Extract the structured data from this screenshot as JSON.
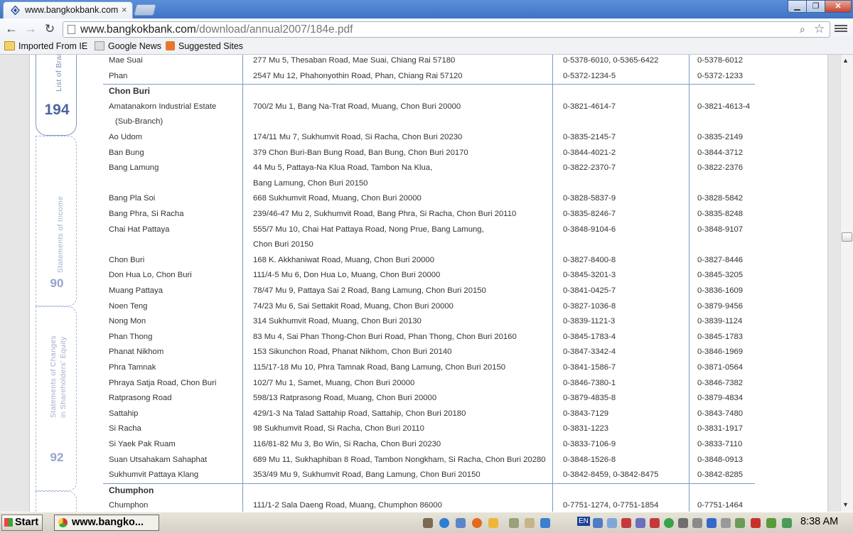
{
  "browser": {
    "tab_title": "www.bangkokbank.com",
    "tab_close": "×",
    "url_domain": "www.bangkokbank.com",
    "url_path": "/download/annual2007/184e.pdf",
    "window_buttons": {
      "minimize": "▁",
      "maximize": "❐",
      "close": "✕"
    }
  },
  "bookmarks": [
    {
      "label": "Imported From IE",
      "icon": "folder-icon"
    },
    {
      "label": "Google News",
      "icon": "news-icon"
    },
    {
      "label": "Suggested Sites",
      "icon": "suggested-sites-icon"
    }
  ],
  "sidebar": {
    "active_label": "List of Branches",
    "active_page": "194",
    "income_label": "Statements of Income",
    "income_page": "90",
    "equity_label_1": "Statements of Changes",
    "equity_label_2": "in Shareholders' Equity",
    "equity_page": "92"
  },
  "rows": [
    {
      "name": "Mae Suai",
      "address": "277 Mu 5, Thesaban Road, Mae Suai, Chiang Rai 57180",
      "phone": "0-5378-6010, 0-5365-6422",
      "fax": "0-5378-6012"
    },
    {
      "name": "Phan",
      "address": "2547 Mu 12, Phahonyothin Road, Phan, Chiang Rai 57120",
      "phone": "0-5372-1234-5",
      "fax": "0-5372-1233"
    },
    {
      "section": "Chon Buri"
    },
    {
      "name": "Amatanakorn Industrial Estate",
      "address": "700/2 Mu 1, Bang Na-Trat Road, Muang, Chon Buri 20000",
      "phone": "0-3821-4614-7",
      "fax": "0-3821-4613-4"
    },
    {
      "name": "(Sub-Branch)",
      "indent": true
    },
    {
      "name": "Ao Udom",
      "address": "174/11 Mu 7, Sukhumvit Road, Si Racha, Chon Buri 20230",
      "phone": "0-3835-2145-7",
      "fax": "0-3835-2149"
    },
    {
      "name": "Ban Bung",
      "address": "379 Chon Buri-Ban Bung Road, Ban Bung, Chon Buri 20170",
      "phone": "0-3844-4021-2",
      "fax": "0-3844-3712"
    },
    {
      "name": "Bang Lamung",
      "address": "44 Mu 5, Pattaya-Na Klua Road, Tambon Na Klua,",
      "phone": "0-3822-2370-7",
      "fax": "0-3822-2376"
    },
    {
      "address": "Bang Lamung, Chon Buri 20150"
    },
    {
      "name": "Bang Pla Soi",
      "address": "668 Sukhumvit Road, Muang, Chon Buri 20000",
      "phone": "0-3828-5837-9",
      "fax": "0-3828-5842"
    },
    {
      "name": "Bang Phra, Si Racha",
      "address": "239/46-47 Mu 2, Sukhumvit Road, Bang Phra, Si Racha, Chon Buri 20110",
      "phone": "0-3835-8246-7",
      "fax": "0-3835-8248"
    },
    {
      "name": "Chai Hat Pattaya",
      "address": "555/7 Mu 10, Chai Hat Pattaya Road, Nong Prue, Bang Lamung,",
      "phone": "0-3848-9104-6",
      "fax": "0-3848-9107"
    },
    {
      "address": "Chon Buri 20150"
    },
    {
      "name": "Chon Buri",
      "address": "168 K. Akkhaniwat Road, Muang, Chon Buri 20000",
      "phone": "0-3827-8400-8",
      "fax": "0-3827-8446"
    },
    {
      "name": "Don Hua Lo, Chon Buri",
      "address": "111/4-5 Mu 6, Don Hua Lo, Muang, Chon Buri 20000",
      "phone": "0-3845-3201-3",
      "fax": "0-3845-3205"
    },
    {
      "name": "Muang Pattaya",
      "address": "78/47 Mu 9, Pattaya Sai 2 Road, Bang Lamung, Chon Buri 20150",
      "phone": "0-3841-0425-7",
      "fax": "0-3836-1609"
    },
    {
      "name": "Noen Teng",
      "address": "74/23 Mu 6, Sai Settakit Road, Muang, Chon Buri 20000",
      "phone": "0-3827-1036-8",
      "fax": "0-3879-9456"
    },
    {
      "name": "Nong Mon",
      "address": "314 Sukhumvit Road, Muang, Chon Buri 20130",
      "phone": "0-3839-1121-3",
      "fax": "0-3839-1124"
    },
    {
      "name": "Phan Thong",
      "address": "83 Mu 4, Sai Phan Thong-Chon Buri Road, Phan Thong, Chon Buri 20160",
      "phone": "0-3845-1783-4",
      "fax": "0-3845-1783"
    },
    {
      "name": "Phanat Nikhom",
      "address": "153 Sikunchon Road, Phanat Nikhom, Chon Buri 20140",
      "phone": "0-3847-3342-4",
      "fax": "0-3846-1969"
    },
    {
      "name": "Phra Tamnak",
      "address": "115/17-18 Mu 10, Phra Tamnak Road, Bang Lamung, Chon Buri 20150",
      "phone": "0-3841-1586-7",
      "fax": "0-3871-0564"
    },
    {
      "name": "Phraya Satja Road, Chon Buri",
      "address": "102/7 Mu 1, Samet, Muang, Chon Buri 20000",
      "phone": "0-3846-7380-1",
      "fax": "0-3846-7382"
    },
    {
      "name": "Ratprasong Road",
      "address": "598/13 Ratprasong Road, Muang, Chon Buri 20000",
      "phone": "0-3879-4835-8",
      "fax": "0-3879-4834"
    },
    {
      "name": "Sattahip",
      "address": "429/1-3 Na Talad Sattahip Road, Sattahip, Chon Buri 20180",
      "phone": "0-3843-7129",
      "fax": "0-3843-7480"
    },
    {
      "name": "Si Racha",
      "address": "98 Sukhumvit Road, Si Racha, Chon Buri 20110",
      "phone": "0-3831-1223",
      "fax": "0-3831-1917"
    },
    {
      "name": "Si Yaek Pak Ruam",
      "address": "116/81-82 Mu 3, Bo Win, Si Racha, Chon Buri 20230",
      "phone": "0-3833-7106-9",
      "fax": "0-3833-7110"
    },
    {
      "name": "Suan Utsahakam Sahaphat",
      "address": "689 Mu 11, Sukhaphiban 8 Road, Tambon Nongkham, Si Racha, Chon Buri 20280",
      "phone": "0-3848-1526-8",
      "fax": "0-3848-0913"
    },
    {
      "name": "Sukhumvit Pattaya Klang",
      "address": "353/49 Mu 9, Sukhumvit Road, Bang Lamung, Chon Buri 20150",
      "phone": "0-3842-8459, 0-3842-8475",
      "fax": "0-3842-8285"
    },
    {
      "section": "Chumphon"
    },
    {
      "name": "Chumphon",
      "address": "111/1-2 Sala Daeng Road, Muang, Chumphon 86000",
      "phone": "0-7751-1274, 0-7751-1854",
      "fax": "0-7751-1464"
    }
  ],
  "taskbar": {
    "start_label": "Start",
    "task_label": "www.bangko...",
    "lang": "EN",
    "clock": "8:38 AM"
  }
}
